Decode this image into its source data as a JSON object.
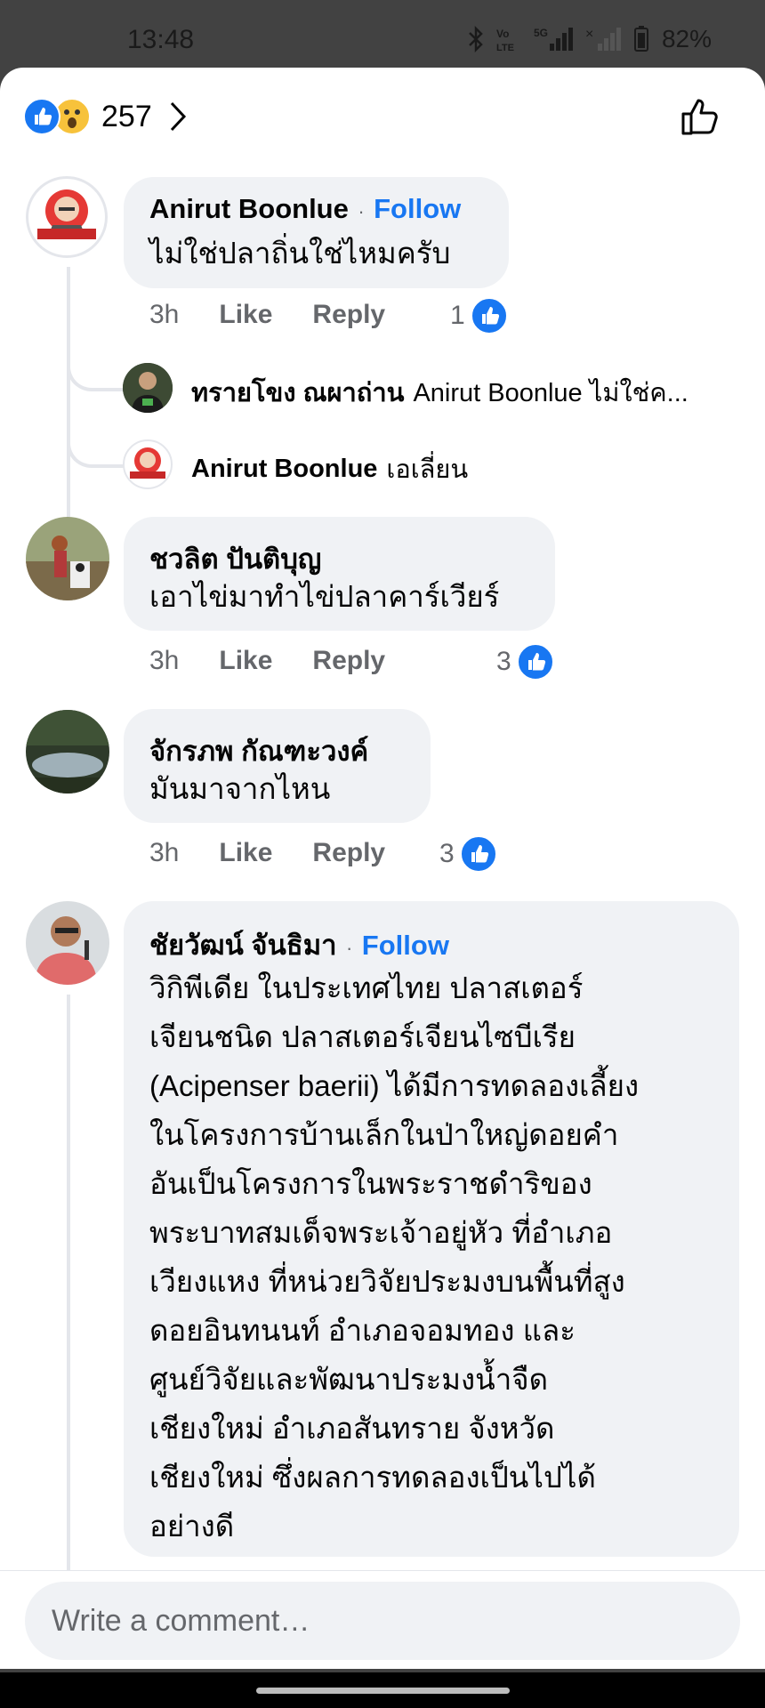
{
  "status_bar": {
    "time": "13:48",
    "network": "5G",
    "battery": "82%"
  },
  "reactions_summary": {
    "count": "257"
  },
  "comments": [
    {
      "name": "Anirut Boonlue",
      "follow": "Follow",
      "text": "ไม่ใช่ปลาถิ่นใช่ไหมครับ",
      "time": "3h",
      "like": "Like",
      "reply": "Reply",
      "likes": "1",
      "replies": [
        {
          "name": "ทรายโขง ณผาถ่าน",
          "text": "Anirut Boonlue ไม่ใช่ค..."
        },
        {
          "name": "Anirut Boonlue",
          "text": "เอเลี่ยน"
        }
      ]
    },
    {
      "name": "ชวลิต ปันติบุญ",
      "text": "เอาไข่มาทำไข่ปลาคาร์เวียร์",
      "time": "3h",
      "like": "Like",
      "reply": "Reply",
      "likes": "3"
    },
    {
      "name": "จักรภพ กัณฑะวงค์",
      "text": "มันมาจากไหน",
      "time": "3h",
      "like": "Like",
      "reply": "Reply",
      "likes": "3"
    },
    {
      "name": "ชัยวัฒน์ จันธิมา",
      "follow": "Follow",
      "lines": [
        "วิกิพีเดีย ในประเทศไทย ปลาสเตอร์",
        "เจียนชนิด ปลาสเตอร์เจียนไซบีเรีย",
        "(Acipenser baerii) ได้มีการทดลองเลี้ยง",
        "ในโครงการบ้านเล็กในป่าใหญ่ดอยคำ",
        "อันเป็นโครงการในพระราชดำริของ",
        "พระบาทสมเด็จพระเจ้าอยู่หัว ที่อำเภอ",
        "เวียงแหง ที่หน่วยวิจัยประมงบนพื้นที่สูง",
        "ดอยอินทนนท์ อำเภอจอมทอง และ",
        "ศูนย์วิจัยและพัฒนาประมงน้ำจืด",
        "เชียงใหม่ อำเภอสันทราย จังหวัด",
        "เชียงใหม่ ซึ่งผลการทดลองเป็นไปได้",
        "อย่างดี"
      ]
    }
  ],
  "composer": {
    "placeholder": "Write a comment…"
  }
}
